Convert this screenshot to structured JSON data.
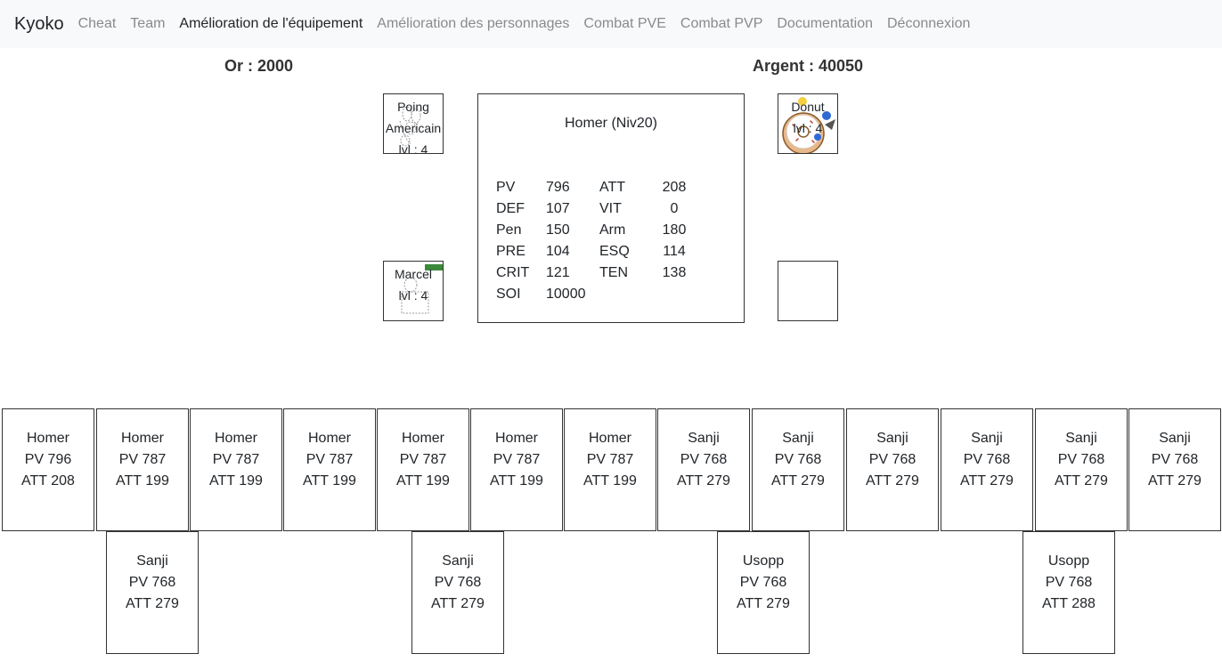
{
  "navbar": {
    "brand": "Kyoko",
    "links": [
      {
        "label": "Cheat"
      },
      {
        "label": "Team"
      },
      {
        "label": "Amélioration de l'équipement",
        "active": true
      },
      {
        "label": "Amélioration des personnages"
      },
      {
        "label": "Combat PVE"
      },
      {
        "label": "Combat PVP"
      },
      {
        "label": "Documentation"
      },
      {
        "label": "Déconnexion"
      }
    ]
  },
  "currency": {
    "gold": "Or : 2000",
    "silver": "Argent : 40050"
  },
  "equipment": {
    "weapon": {
      "line1": "Poing",
      "line2": "Americain",
      "line3": "lvl : 4",
      "icon": "brass-knuckles-icon"
    },
    "food": {
      "line1": "Donut",
      "line2": "lvl : 4",
      "icon": "donut-icon"
    },
    "pet": {
      "line1": "Marcel",
      "line2": "lvl : 4",
      "icon": "pet-icon"
    },
    "empty": {}
  },
  "character": {
    "title": "Homer (Niv20)",
    "stats": [
      {
        "l1": "PV",
        "v1": "796",
        "l2": "ATT",
        "v2": "208"
      },
      {
        "l1": "DEF",
        "v1": "107",
        "l2": "VIT",
        "v2": "0"
      },
      {
        "l1": "Pen",
        "v1": "150",
        "l2": "Arm",
        "v2": "180"
      },
      {
        "l1": "PRE",
        "v1": "104",
        "l2": "ESQ",
        "v2": "114"
      },
      {
        "l1": "CRIT",
        "v1": "121",
        "l2": "TEN",
        "v2": "138"
      },
      {
        "l1": "SOI",
        "v1": "10000",
        "l2": "",
        "v2": ""
      }
    ]
  },
  "roster": [
    {
      "name": "Homer",
      "pv": "PV 796",
      "att": "ATT 208"
    },
    {
      "name": "Homer",
      "pv": "PV 787",
      "att": "ATT 199"
    },
    {
      "name": "Homer",
      "pv": "PV 787",
      "att": "ATT 199"
    },
    {
      "name": "Homer",
      "pv": "PV 787",
      "att": "ATT 199"
    },
    {
      "name": "Homer",
      "pv": "PV 787",
      "att": "ATT 199"
    },
    {
      "name": "Homer",
      "pv": "PV 787",
      "att": "ATT 199"
    },
    {
      "name": "Homer",
      "pv": "PV 787",
      "att": "ATT 199"
    },
    {
      "name": "Sanji",
      "pv": "PV 768",
      "att": "ATT 279"
    },
    {
      "name": "Sanji",
      "pv": "PV 768",
      "att": "ATT 279"
    },
    {
      "name": "Sanji",
      "pv": "PV 768",
      "att": "ATT 279"
    },
    {
      "name": "Sanji",
      "pv": "PV 768",
      "att": "ATT 279"
    },
    {
      "name": "Sanji",
      "pv": "PV 768",
      "att": "ATT 279"
    },
    {
      "name": "Sanji",
      "pv": "PV 768",
      "att": "ATT 279"
    },
    {
      "name": "Sanji",
      "pv": "PV 768",
      "att": "ATT 279"
    },
    {
      "name": "Sanji",
      "pv": "PV 768",
      "att": "ATT 279"
    },
    {
      "name": "Usopp",
      "pv": "PV 768",
      "att": "ATT 279"
    },
    {
      "name": "Usopp",
      "pv": "PV 768",
      "att": "ATT 288"
    }
  ]
}
